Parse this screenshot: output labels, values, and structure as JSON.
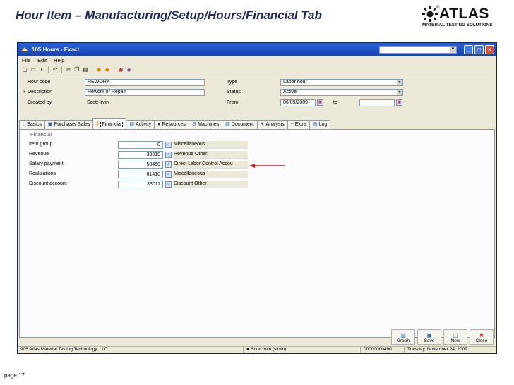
{
  "slide": {
    "title": "Hour Item – Manufacturing/Setup/Hours/Financial Tab",
    "page_label": "page 17"
  },
  "logo": {
    "word": "ATLAS",
    "registered": "®",
    "subtitle": "MATERIAL TESTING SOLUTIONS"
  },
  "window": {
    "title": "105 Hours - Exact",
    "minimize": "_",
    "maximize": "□",
    "close": "×"
  },
  "menu": [
    "File",
    "Edit",
    "Help"
  ],
  "header": {
    "hour_code_label": "Hour code",
    "hour_code_value": "REWORK",
    "description_label": "Description",
    "description_marker": "›",
    "description_value": "Rework or Repair",
    "created_by_label": "Created by",
    "created_by_value": "Scott Irvin",
    "type_label": "Type",
    "type_value": "Labor hour",
    "status_label": "Status",
    "status_value": "Active",
    "from_label": "From",
    "from_value": "06/09/2009",
    "to_label": "to",
    "to_value": ""
  },
  "tabs": [
    {
      "label": "Basics",
      "icon": "home-icon"
    },
    {
      "label": "Purchase/ Sales",
      "icon": "cart-icon"
    },
    {
      "label": "Financial",
      "icon": "money-icon"
    },
    {
      "label": "Activity",
      "icon": "activity-icon"
    },
    {
      "label": "Resources",
      "icon": "resources-icon"
    },
    {
      "label": "Machines",
      "icon": "machines-icon"
    },
    {
      "label": "Document",
      "icon": "document-icon"
    },
    {
      "label": "Analysis",
      "icon": "analysis-icon"
    },
    {
      "label": "Extra",
      "icon": "extra-icon"
    },
    {
      "label": "Log",
      "icon": "log-icon"
    }
  ],
  "financial": {
    "group_title": "Financial",
    "rows": [
      {
        "label": "Item group",
        "code": "0",
        "description": "Miscellaneous"
      },
      {
        "label": "Revenue",
        "code": "33010",
        "description": "Revenue Other"
      },
      {
        "label": "Salary payment",
        "code": "50450",
        "description": "Direct Labor Control Accou"
      },
      {
        "label": "Realizations",
        "code": "61410",
        "description": "Miscellaneous"
      },
      {
        "label": "Discount account",
        "code": "33011",
        "description": "Discount Other"
      }
    ]
  },
  "buttons": {
    "graph": "Graph",
    "save": "Save",
    "new": "New",
    "close": "Close"
  },
  "status": {
    "company": "905 Atlas Material Testing Technology, LLC",
    "user": "Scott Irvin (sirvin)",
    "record": "00000000490",
    "date": "Tuesday, November 24, 2009"
  },
  "colors": {
    "title_text": "#1f2a5c",
    "window_bg": "#ece9d8",
    "titlebar": "#2a63d8",
    "annotation_arrow": "#cc2222"
  }
}
